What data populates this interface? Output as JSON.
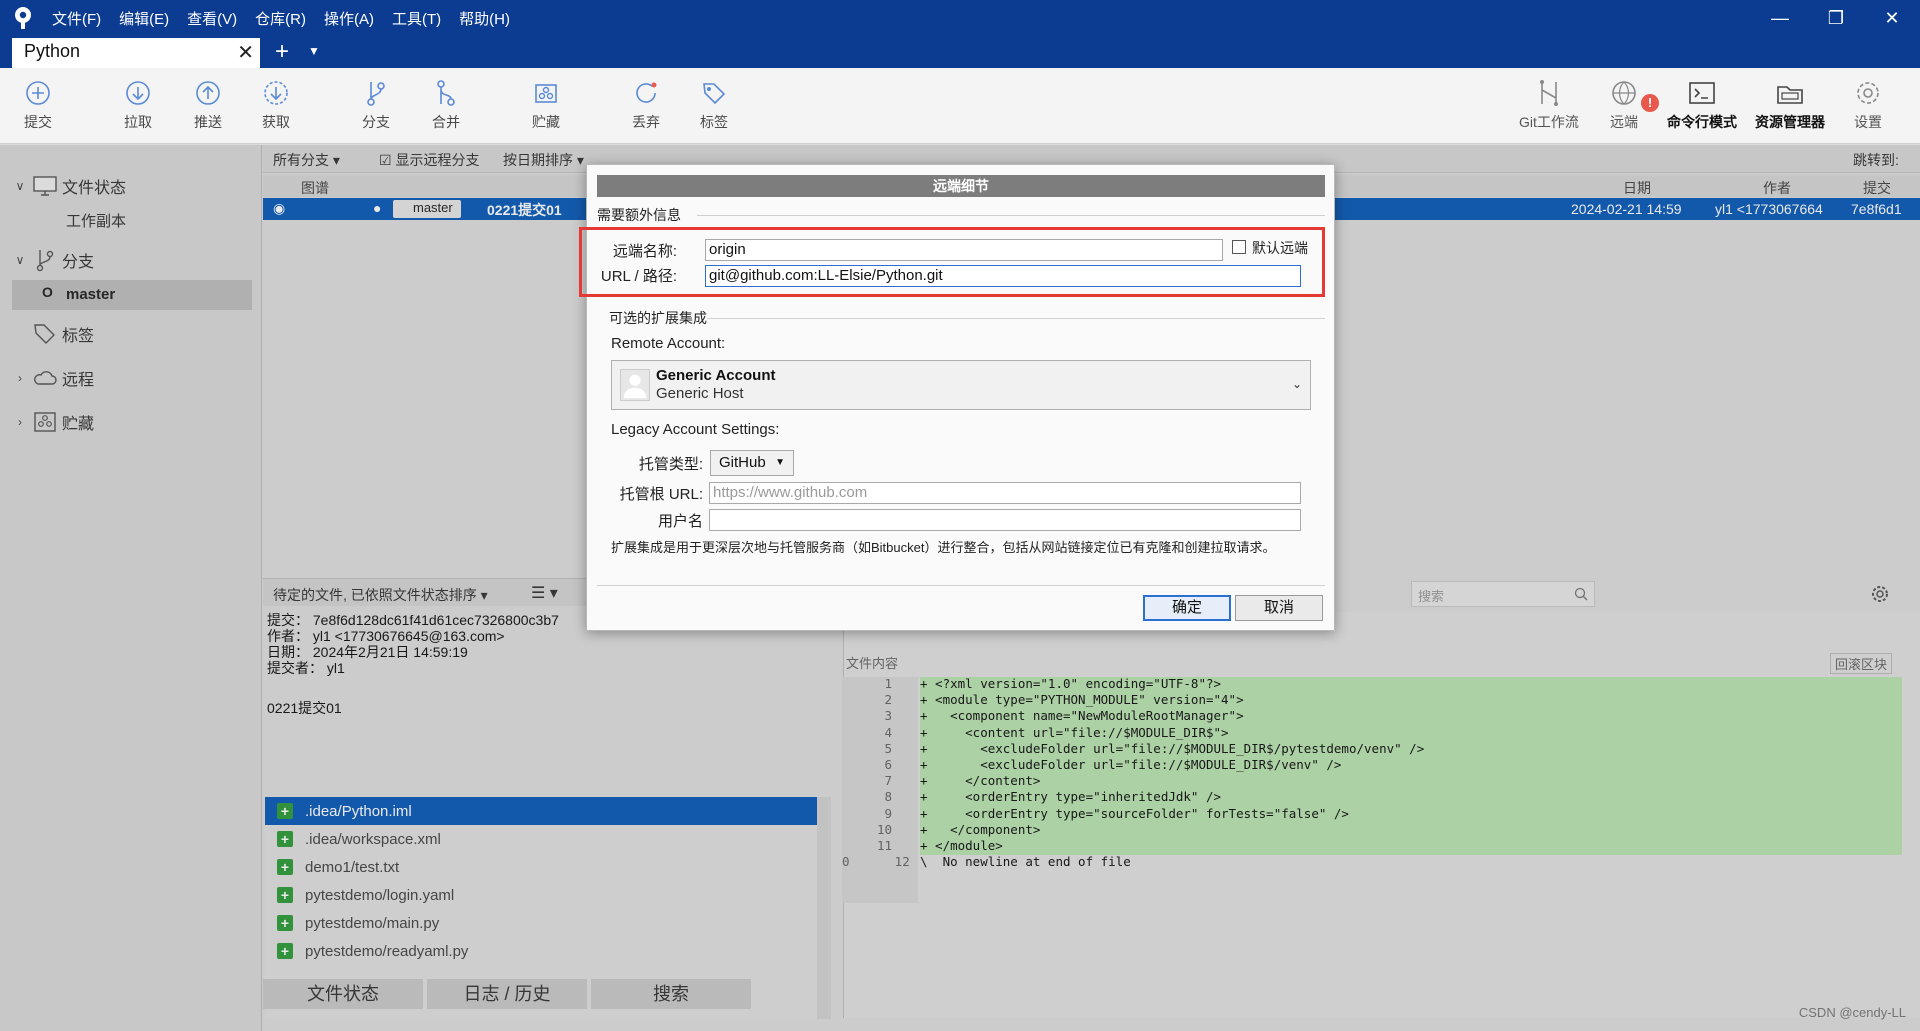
{
  "menu": [
    "文件(F)",
    "编辑(E)",
    "查看(V)",
    "仓库(R)",
    "操作(A)",
    "工具(T)",
    "帮助(H)"
  ],
  "tab": {
    "title": "Python"
  },
  "toolbar": {
    "left": [
      {
        "label": "提交",
        "icon": "commit-plus-icon"
      },
      {
        "label": "拉取",
        "icon": "pull-down-icon"
      },
      {
        "label": "推送",
        "icon": "push-up-icon"
      },
      {
        "label": "获取",
        "icon": "fetch-icon"
      },
      {
        "label": "分支",
        "icon": "branch-icon"
      },
      {
        "label": "合并",
        "icon": "merge-icon"
      },
      {
        "label": "贮藏",
        "icon": "stash-icon"
      },
      {
        "label": "丢弃",
        "icon": "discard-icon"
      },
      {
        "label": "标签",
        "icon": "tag-icon"
      }
    ],
    "right": [
      {
        "label": "Git工作流",
        "icon": "gitflow-icon"
      },
      {
        "label": "远端",
        "icon": "globe-icon"
      },
      {
        "label": "命令行模式",
        "icon": "terminal-icon"
      },
      {
        "label": "资源管理器",
        "icon": "explorer-icon"
      },
      {
        "label": "设置",
        "icon": "gear-icon"
      }
    ],
    "remote_alert": "!"
  },
  "sidebar": {
    "file_status": "文件状态",
    "working_copy": "工作副本",
    "branches": "分支",
    "master": "master",
    "tags": "标签",
    "remotes": "远程",
    "stashes": "贮藏"
  },
  "filterbar": {
    "all_branches": "所有分支",
    "show_remote": "显示远程分支",
    "sort_by_date": "按日期排序",
    "jump_to": "跳转到:"
  },
  "columns": {
    "graph": "图谱",
    "date": "日期",
    "author": "作者",
    "commit": "提交"
  },
  "commit_row": {
    "branch": "master",
    "message": "0221提交01",
    "date": "2024-02-21 14:59",
    "author": "yl1 <1773067664",
    "hash": "7e8f6d1"
  },
  "pending": {
    "label": "待定的文件, 已依照文件状态排序"
  },
  "commit_info": {
    "commit": "提交： 7e8f6d128dc61f41d61cec7326800c3b7",
    "author": "作者： yl1 <17730676645@163.com>",
    "date": "日期： 2024年2月21日 14:59:19",
    "committer": "提交者： yl1",
    "message": "0221提交01"
  },
  "files": [
    ".idea/Python.iml",
    ".idea/workspace.xml",
    "demo1/test.txt",
    "pytestdemo/login.yaml",
    "pytestdemo/main.py",
    "pytestdemo/readyaml.py"
  ],
  "bottom_tabs": [
    "文件状态",
    "日志 / 历史",
    "搜索"
  ],
  "diff": {
    "search_placeholder": "搜索",
    "file_content_label": "文件内容",
    "hunk_button": "回滚区块",
    "lines": [
      {
        "n": "1",
        "t": "+ <?xml version=\"1.0\" encoding=\"UTF-8\"?>"
      },
      {
        "n": "2",
        "t": "+ <module type=\"PYTHON_MODULE\" version=\"4\">"
      },
      {
        "n": "3",
        "t": "+   <component name=\"NewModuleRootManager\">"
      },
      {
        "n": "4",
        "t": "+     <content url=\"file://$MODULE_DIR$\">"
      },
      {
        "n": "5",
        "t": "+       <excludeFolder url=\"file://$MODULE_DIR$/pytestdemo/venv\" />"
      },
      {
        "n": "6",
        "t": "+       <excludeFolder url=\"file://$MODULE_DIR$/venv\" />"
      },
      {
        "n": "7",
        "t": "+     </content>"
      },
      {
        "n": "8",
        "t": "+     <orderEntry type=\"inheritedJdk\" />"
      },
      {
        "n": "9",
        "t": "+     <orderEntry type=\"sourceFolder\" forTests=\"false\" />"
      },
      {
        "n": "10",
        "t": "+   </component>"
      },
      {
        "n": "11",
        "t": "+ </module>"
      },
      {
        "n": "0      12",
        "t": "\\  No newline at end of file"
      }
    ]
  },
  "dialog": {
    "title": "远端细节",
    "required_section": "需要额外信息",
    "remote_name_label": "远端名称:",
    "remote_name_value": "origin",
    "default_remote": "默认远端",
    "url_label": "URL / 路径:",
    "url_value": "git@github.com:LL-Elsie/Python.git",
    "optional_section": "可选的扩展集成",
    "remote_account_label": "Remote Account:",
    "account_name": "Generic Account",
    "account_host": "Generic Host",
    "legacy_label": "Legacy Account Settings:",
    "host_type_label": "托管类型:",
    "host_type_value": "GitHub",
    "host_root_label": "托管根 URL:",
    "host_root_placeholder": "https://www.github.com",
    "username_label": "用户名",
    "description": "扩展集成是用于更深层次地与托管服务商（如Bitbucket）进行整合，包括从网站链接定位已有克隆和创建拉取请求。",
    "ok": "确定",
    "cancel": "取消"
  },
  "watermark": "CSDN @cendy-LL",
  "colors": {
    "titlebar": "#0b3c91",
    "selection": "#0b5bb8",
    "highlight_box": "#e53935",
    "diff_added": "#b9e3b1"
  }
}
